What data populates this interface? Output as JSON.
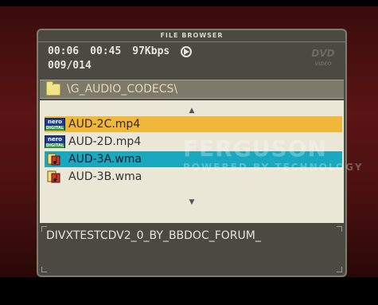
{
  "window": {
    "title": "FILE BROWSER"
  },
  "status": {
    "elapsed": "00:06",
    "total": "00:45",
    "bitrate": "97Kbps",
    "track": "009/014"
  },
  "path": {
    "folder": "\\G_AUDIO_CODECS\\"
  },
  "files": [
    {
      "name": "AUD-2C.mp4",
      "icon": "nero-digital-icon",
      "state": "selected-orange"
    },
    {
      "name": "AUD-2D.mp4",
      "icon": "nero-digital-icon",
      "state": "normal"
    },
    {
      "name": "AUD-3A.wma",
      "icon": "audio-file-icon",
      "state": "highlighted-cyan"
    },
    {
      "name": "AUD-3B.wma",
      "icon": "audio-file-icon",
      "state": "normal"
    }
  ],
  "info_field": {
    "text": "DIVXTESTCDV2_0_BY_BBDOC_FORUM_"
  },
  "nero_badge": {
    "top": "nero",
    "bottom": "DIGITAL"
  },
  "dvd_logo": {
    "top": "DVD",
    "bottom": "VIDEO"
  },
  "watermark": {
    "line1": "FERGUSON",
    "line2": "POWERED BY TECHNOLOGY"
  },
  "colors": {
    "selection_orange": "#f1b73b",
    "selection_cyan": "#1aa8c0",
    "panel": "#4a4a42",
    "list_bg": "#ebe7d7"
  }
}
